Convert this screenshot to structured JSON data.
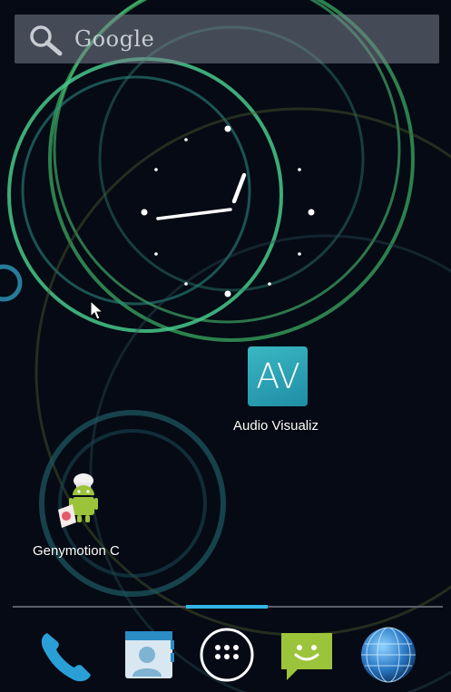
{
  "search": {
    "label": "Google"
  },
  "apps": [
    {
      "label": "Audio Visualiz",
      "tile_text": "AV"
    },
    {
      "label": "Genymotion C"
    }
  ],
  "dock": [
    {
      "icon": "phone-icon"
    },
    {
      "icon": "contacts-icon"
    },
    {
      "icon": "all-apps-icon"
    },
    {
      "icon": "messaging-icon"
    },
    {
      "icon": "browser-icon"
    }
  ],
  "colors": {
    "accent": "#33b5e5",
    "ring_green": "#4fcf7a",
    "background": "#050a14"
  }
}
